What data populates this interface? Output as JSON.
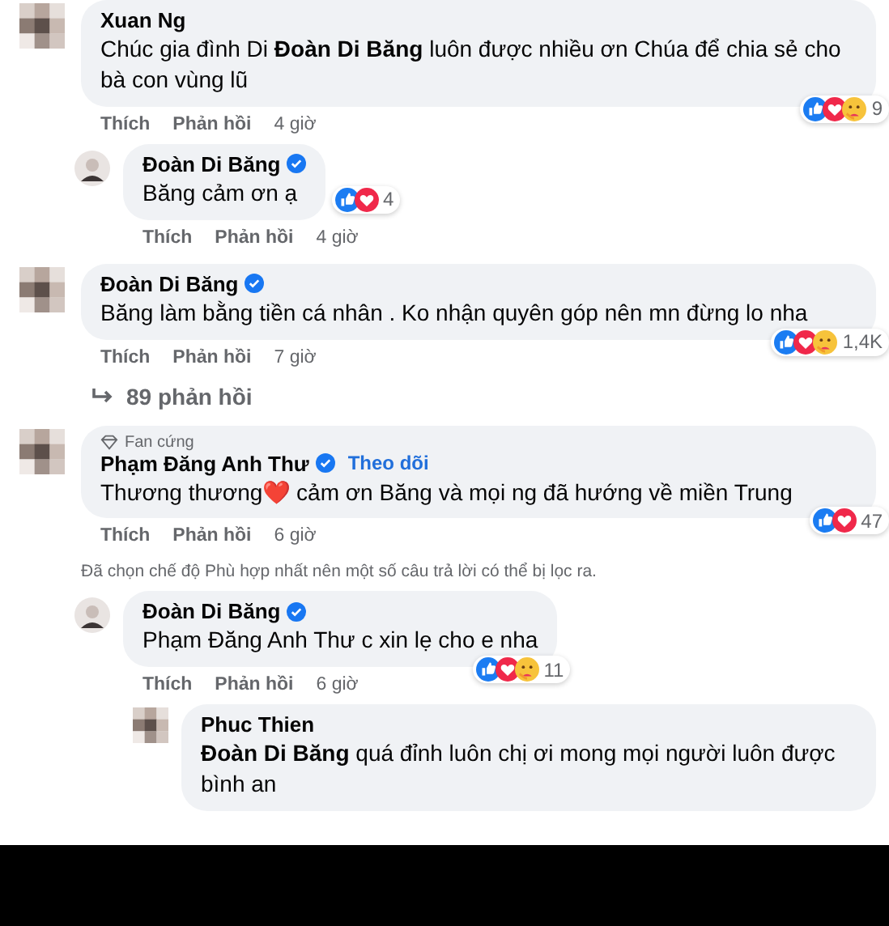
{
  "comments": [
    {
      "author": "Xuan Ng",
      "avatar": {
        "kind": "mosaic"
      },
      "verified": false,
      "text": "Chúc gia đình Di **Đoàn Di Băng** luôn được nhiều ơn Chúa để chia sẻ cho bà con vùng lũ",
      "reactions": {
        "icons": [
          {
            "kind": "like"
          },
          {
            "kind": "love"
          },
          {
            "kind": "care"
          }
        ],
        "count": "9"
      },
      "actions": [
        "Thích",
        "Phản hồi"
      ],
      "time": "4 giờ",
      "children": [
        {
          "author": "Đoàn Di Băng",
          "avatar": {
            "kind": "photo"
          },
          "verified": true,
          "text": "Băng cảm ơn ạ",
          "reactions": {
            "icons": [
              {
                "kind": "like"
              },
              {
                "kind": "love"
              }
            ],
            "count": "4"
          },
          "actions": [
            "Thích",
            "Phản hồi"
          ],
          "time": "4 giờ"
        }
      ]
    },
    {
      "author": "Đoàn Di Băng",
      "avatar": {
        "kind": "mosaic"
      },
      "verified": true,
      "text": "Băng làm bằng tiền cá nhân . Ko nhận quyên góp nên mn đừng lo nha",
      "reactions": {
        "icons": [
          {
            "kind": "like"
          },
          {
            "kind": "love"
          },
          {
            "kind": "care"
          }
        ],
        "count": "1,4K"
      },
      "actions": [
        "Thích",
        "Phản hồi"
      ],
      "time": "7 giờ",
      "more_replies": "89 phản hồi"
    },
    {
      "author": "Phạm Đăng Anh Thư",
      "avatar": {
        "kind": "mosaic"
      },
      "badge": "Fan cứng",
      "verified": true,
      "follow": "Theo dõi",
      "text": "Thương thương❤️ cảm ơn Băng và mọi ng đã hướng về miền Trung",
      "reactions": {
        "icons": [
          {
            "kind": "like"
          },
          {
            "kind": "love"
          }
        ],
        "count": "47"
      },
      "actions": [
        "Thích",
        "Phản hồi"
      ],
      "time": "6 giờ",
      "notice": "Đã chọn chế độ Phù hợp nhất nên một số câu trả lời có thể bị lọc ra.",
      "children": [
        {
          "author": "Đoàn Di Băng",
          "avatar": {
            "kind": "photo"
          },
          "verified": true,
          "text": "Phạm Đăng Anh Thư c xin lẹ cho e nha",
          "reactions": {
            "icons": [
              {
                "kind": "like"
              },
              {
                "kind": "love"
              },
              {
                "kind": "care"
              }
            ],
            "count": "11"
          },
          "actions": [
            "Thích",
            "Phản hồi"
          ],
          "time": "6 giờ",
          "children": [
            {
              "author": "Phuc Thien",
              "avatar": {
                "kind": "mosaic"
              },
              "verified": false,
              "text": "**Đoàn Di Băng** quá đỉnh luôn chị ơi mong mọi người luôn được bình an"
            }
          ]
        }
      ]
    }
  ]
}
